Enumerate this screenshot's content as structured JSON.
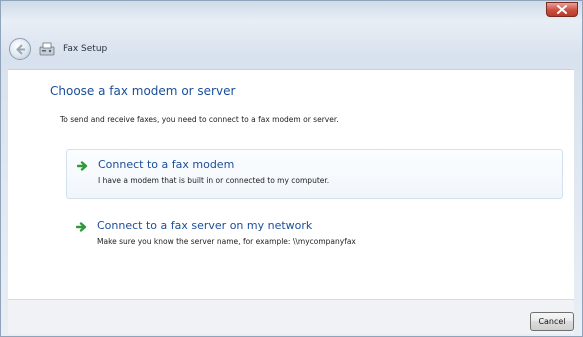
{
  "window": {
    "title": "Fax Setup",
    "close_icon": "close-icon",
    "back_icon": "back-arrow-icon",
    "app_icon": "fax-icon",
    "accent_color": "#1a4e9a",
    "close_color": "#c9503f"
  },
  "main": {
    "heading": "Choose a fax modem or server",
    "instruction": "To send and receive faxes, you need to connect to a fax modem or server.",
    "options": [
      {
        "title": "Connect to a fax modem",
        "description": "I have a modem that is built in or connected to my computer.",
        "icon": "green-arrow-icon"
      },
      {
        "title": "Connect to a fax server on my network",
        "description": "Make sure you know the server name, for example: \\\\mycompanyfax",
        "icon": "green-arrow-icon"
      }
    ]
  },
  "footer": {
    "cancel_label": "Cancel"
  }
}
